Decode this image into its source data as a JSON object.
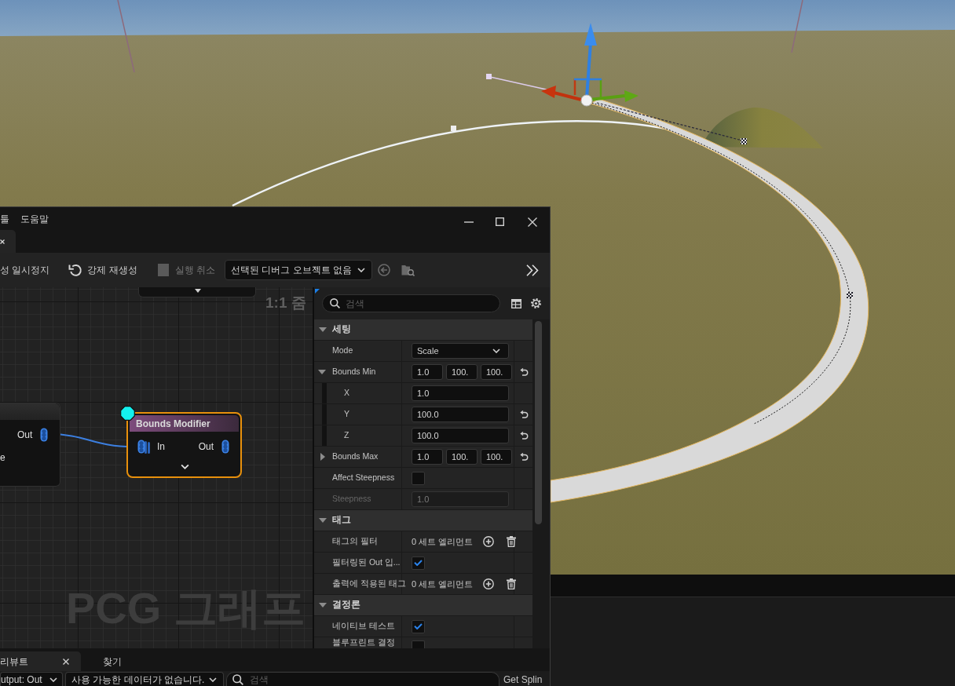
{
  "menu": [
    {
      "label": "툴"
    },
    {
      "label": "도움말"
    }
  ],
  "document_tab": {
    "closable": true
  },
  "toolbar": [
    {
      "kind": "text",
      "label": "성 일시정지",
      "disabled": false
    },
    {
      "kind": "regenerate",
      "label": "강제 재생성",
      "disabled": false
    },
    {
      "kind": "stop",
      "label": "실행 취소",
      "disabled": true
    }
  ],
  "debug_object": {
    "value": "선택된 디버그 오브젝트 없음"
  },
  "graph": {
    "zoom_label": "1:1 줌",
    "watermark": "PCG 그래프",
    "nodes": [
      {
        "kind": "stub",
        "selected": false,
        "debug": false
      },
      {
        "kind": "partial",
        "selected": false,
        "debug": false,
        "outputs": [
          "Out"
        ],
        "fragment": "e"
      },
      {
        "kind": "full",
        "title": "Bounds Modifier",
        "selected": true,
        "debug": true,
        "inputs": [
          "In"
        ],
        "outputs": [
          "Out"
        ]
      }
    ]
  },
  "details": {
    "search": {
      "placeholder": "검색"
    },
    "sections": [
      {
        "title": "세팅",
        "expanded": true,
        "rows": [
          {
            "kind": "combo",
            "label": "Mode",
            "value": "Scale",
            "disabled": false,
            "reset": false
          },
          {
            "kind": "vector",
            "label": "Bounds Min",
            "values": [
              "1.0",
              "100.",
              "100."
            ],
            "expanded": true,
            "disabled": false,
            "reset": true,
            "children": [
              {
                "kind": "number",
                "label": "X",
                "value": "1.0",
                "disabled": false,
                "reset": false
              },
              {
                "kind": "number",
                "label": "Y",
                "value": "100.0",
                "disabled": false,
                "reset": true
              },
              {
                "kind": "number",
                "label": "Z",
                "value": "100.0",
                "disabled": false,
                "reset": true
              }
            ]
          },
          {
            "kind": "vector",
            "label": "Bounds Max",
            "values": [
              "1.0",
              "100.",
              "100."
            ],
            "expanded": false,
            "disabled": false,
            "reset": true
          },
          {
            "kind": "checkbox",
            "label": "Affect Steepness",
            "checked": false,
            "disabled": false,
            "reset": false
          },
          {
            "kind": "number",
            "label": "Steepness",
            "value": "1.0",
            "disabled": true,
            "reset": false
          }
        ]
      },
      {
        "title": "태그",
        "expanded": true,
        "rows": [
          {
            "kind": "array",
            "label": "태그의 필터",
            "value": "0 세트 엘리먼트",
            "disabled": false,
            "reset": false
          },
          {
            "kind": "checkbox",
            "label": "필터링된 Out 입...",
            "checked": true,
            "disabled": false,
            "reset": false
          },
          {
            "kind": "array",
            "label": "출력에 적용된 태그",
            "value": "0 세트 엘리먼트",
            "disabled": false,
            "reset": false
          }
        ]
      },
      {
        "title": "결정론",
        "expanded": true,
        "rows": [
          {
            "kind": "checkbox",
            "label": "네이티브 테스트",
            "checked": true,
            "disabled": false,
            "reset": false
          },
          {
            "kind": "checkbox",
            "label": "블루프린트 결정",
            "checked": false,
            "disabled": false,
            "reset": false
          }
        ]
      }
    ]
  },
  "bottom_panel": {
    "tabs": [
      {
        "label": "리뷰트",
        "selected": true,
        "closable": true
      },
      {
        "label": "찾기",
        "selected": false,
        "closable": false
      }
    ],
    "pin_filter": "utput: Out",
    "data_filter": "사용 가능한 데이터가 없습니다.",
    "search": {
      "placeholder": "검색"
    },
    "trailing_label": "Get Splin"
  }
}
